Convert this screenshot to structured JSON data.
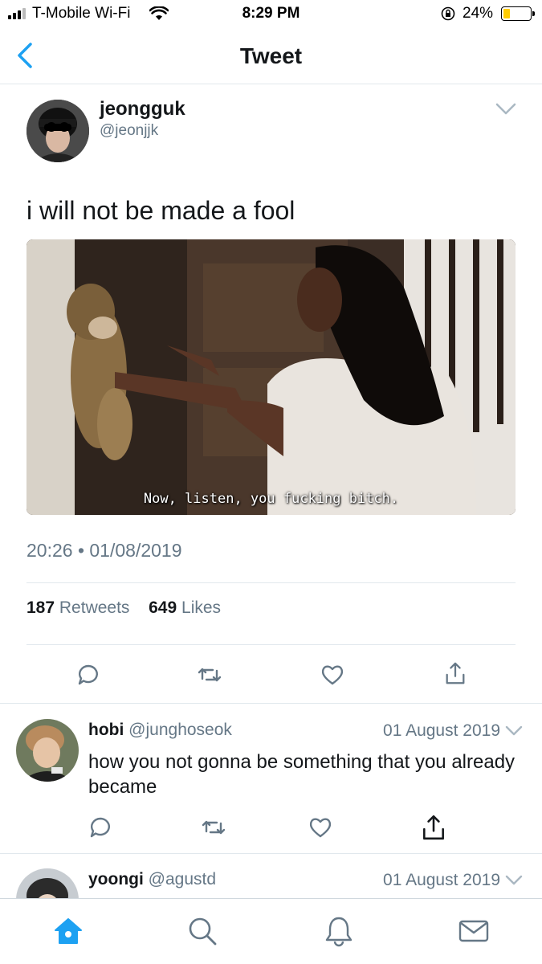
{
  "status_bar": {
    "carrier": "T-Mobile Wi-Fi",
    "time": "8:29 PM",
    "battery": "24%",
    "battery_level": 0.24
  },
  "nav": {
    "title": "Tweet",
    "back_icon": "chevron-left-icon"
  },
  "tweet": {
    "display_name": "jeongguk",
    "handle": "@jeonjjk",
    "text": "i will not be made a fool",
    "media_subtitle": "Now, listen, you fucking bitch.",
    "timestamp": "20:26 • 01/08/2019",
    "retweets_count": "187",
    "retweets_label": "Retweets",
    "likes_count": "649",
    "likes_label": "Likes",
    "actions": [
      "reply-icon",
      "retweet-icon",
      "like-icon",
      "share-icon"
    ]
  },
  "replies": [
    {
      "name": "hobi",
      "handle": "@junghoseok",
      "date": "01 August 2019",
      "text": "how you not gonna be something that you already became"
    },
    {
      "name": "yoongi",
      "handle": "@agustd",
      "date": "01 August 2019"
    }
  ],
  "tab_bar": {
    "items": [
      "home-icon",
      "search-icon",
      "notifications-icon",
      "messages-icon"
    ]
  },
  "colors": {
    "accent": "#1da1f2",
    "secondary_text": "#657786",
    "divider": "#e1e8ed"
  }
}
